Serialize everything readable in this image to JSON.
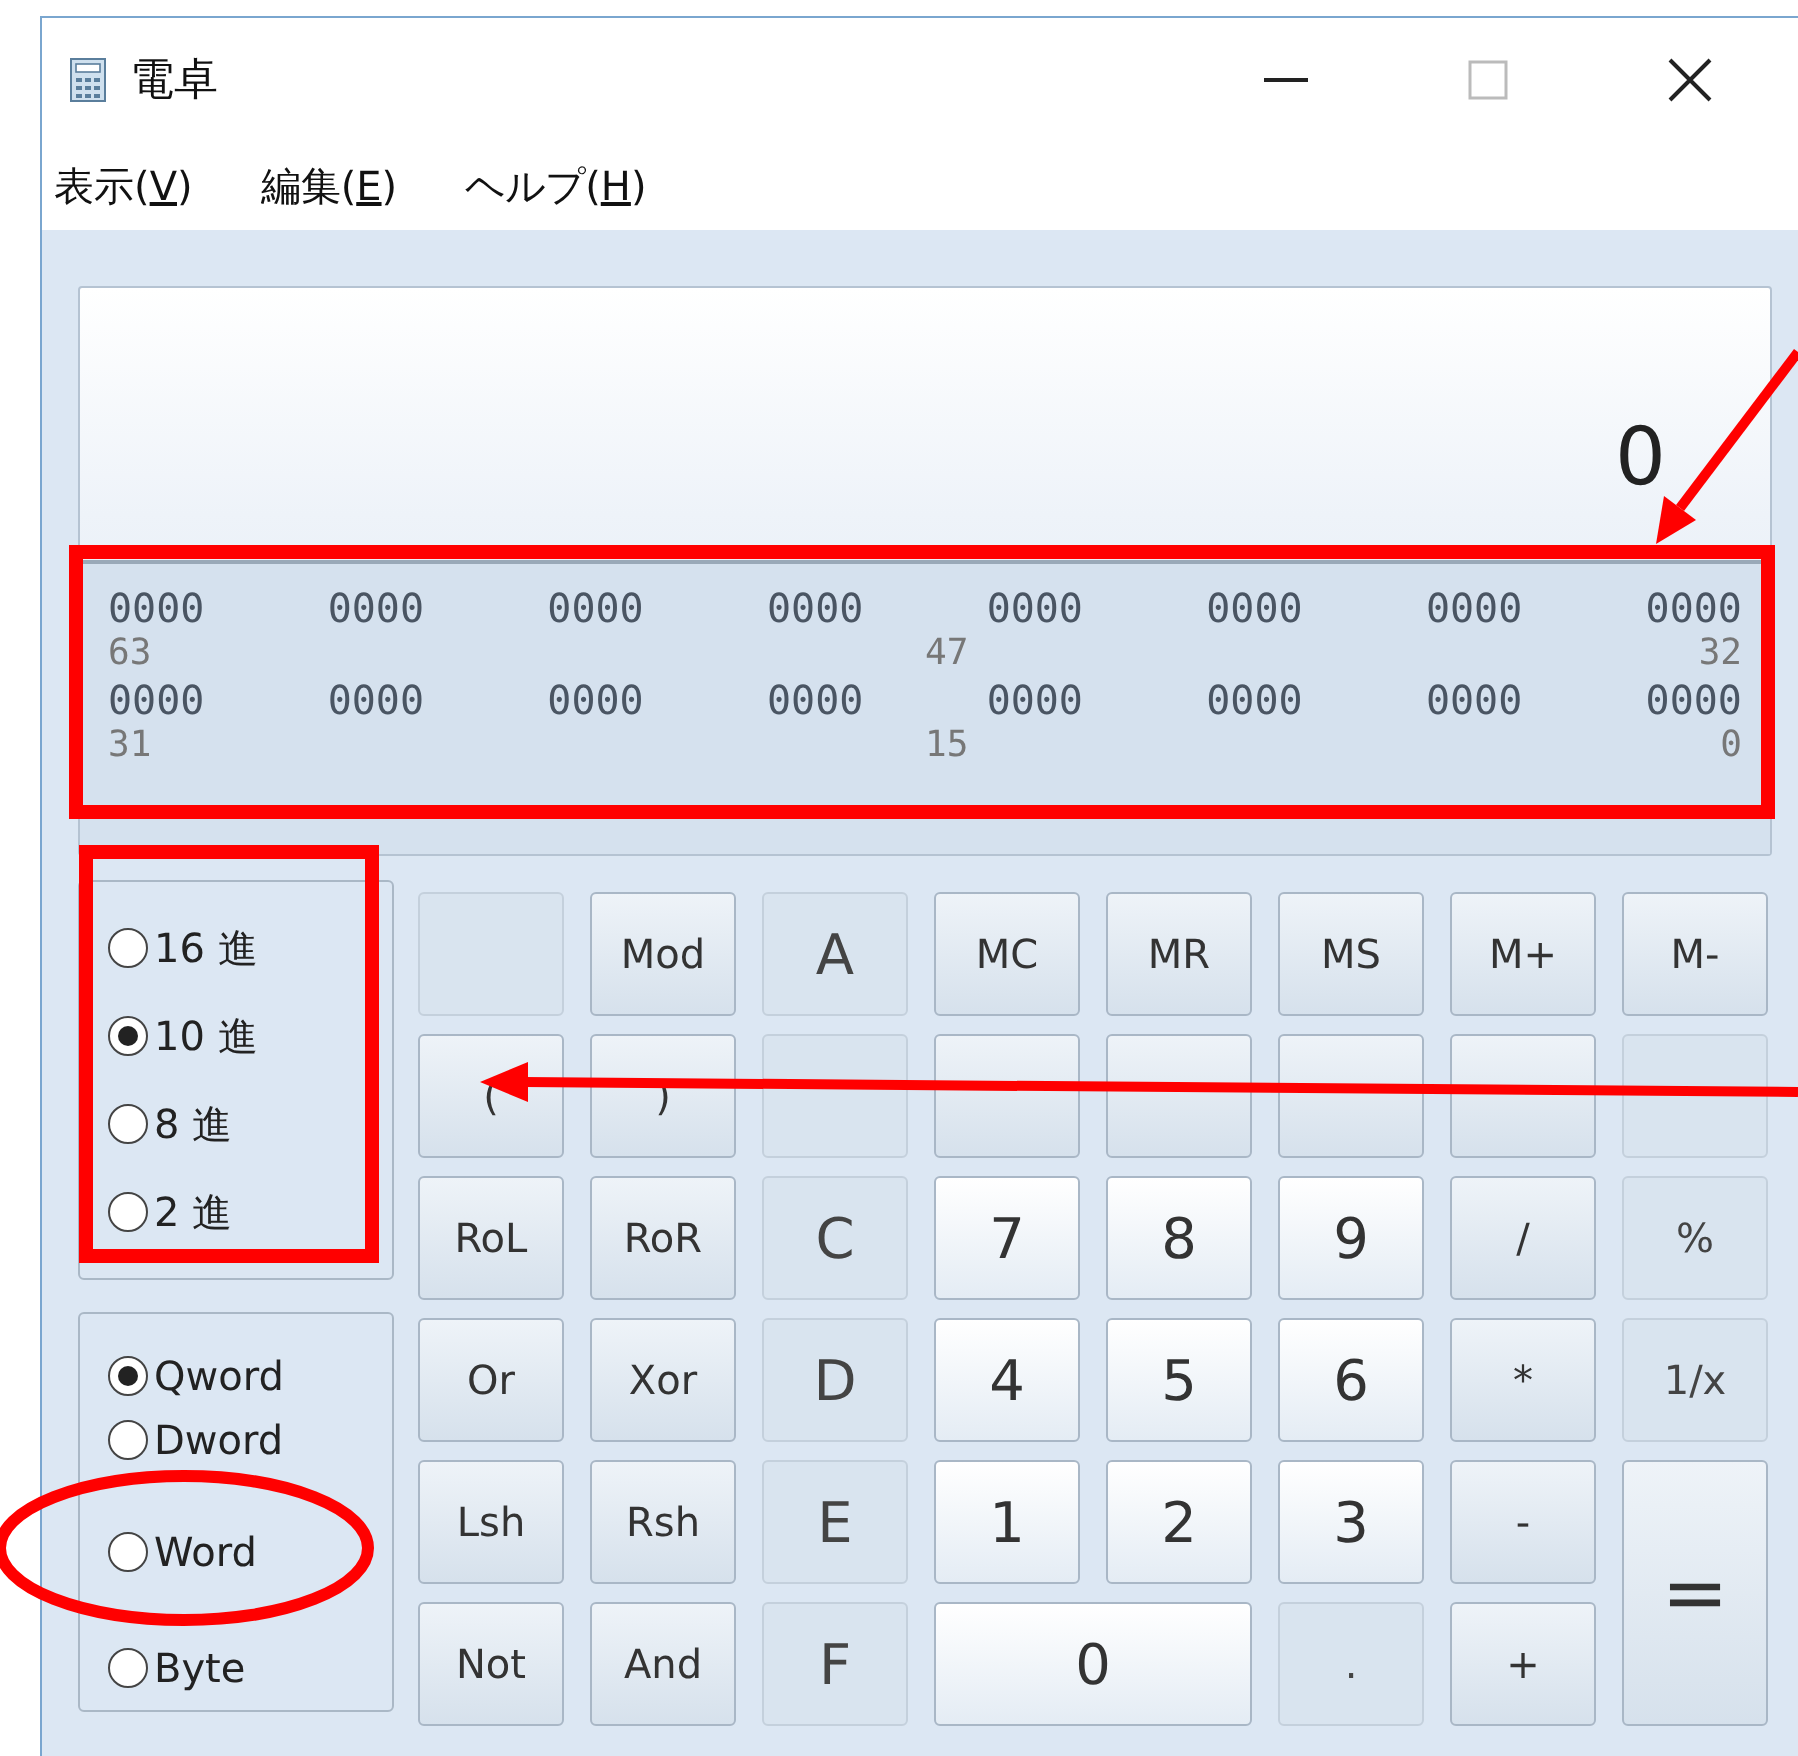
{
  "window": {
    "title": "電卓"
  },
  "menu": [
    {
      "before": "表示(",
      "key": "V",
      "after": ")"
    },
    {
      "before": "編集(",
      "key": "E",
      "after": ")"
    },
    {
      "before": "ヘルプ(",
      "key": "H",
      "after": ")"
    }
  ],
  "display": {
    "value": "0",
    "bit_rows": [
      {
        "digits": [
          "0000",
          "0000",
          "0000",
          "0000",
          "0000",
          "0000",
          "0000",
          "0000"
        ],
        "labels": [
          "63",
          "47",
          "32"
        ]
      },
      {
        "digits": [
          "0000",
          "0000",
          "0000",
          "0000",
          "0000",
          "0000",
          "0000",
          "0000"
        ],
        "labels": [
          "31",
          "15",
          "0"
        ]
      }
    ]
  },
  "radix": [
    {
      "label": "16 進",
      "selected": false
    },
    {
      "label": "10 進",
      "selected": true
    },
    {
      "label": "8 進",
      "selected": false
    },
    {
      "label": "2 進",
      "selected": false
    }
  ],
  "word_size": [
    {
      "label": "Qword",
      "selected": true
    },
    {
      "label": "Dword",
      "selected": false
    },
    {
      "label": "Word",
      "selected": false
    },
    {
      "label": "Byte",
      "selected": false
    }
  ],
  "keys": [
    {
      "kind": "normal",
      "disabled": true
    },
    {
      "label": "Mod",
      "kind": "normal",
      "disabled": false
    },
    {
      "label": "A",
      "kind": "normal",
      "disabled": true
    },
    {
      "label": "MC",
      "kind": "normal",
      "disabled": false
    },
    {
      "label": "MR",
      "kind": "normal",
      "disabled": false
    },
    {
      "label": "MS",
      "kind": "normal",
      "disabled": false
    },
    {
      "label": "M+",
      "kind": "normal",
      "disabled": false
    },
    {
      "label": "M-",
      "kind": "normal",
      "disabled": false
    },
    {
      "label": "(",
      "kind": "normal",
      "disabled": false
    },
    {
      "label": ")",
      "kind": "normal",
      "disabled": false
    },
    {
      "kind": "normal",
      "disabled": true
    },
    {
      "kind": "normal",
      "disabled": false
    },
    {
      "kind": "normal",
      "disabled": false
    },
    {
      "kind": "normal",
      "disabled": false
    },
    {
      "kind": "normal",
      "disabled": false
    },
    {
      "kind": "normal",
      "disabled": true
    },
    {
      "label": "RoL",
      "kind": "normal",
      "disabled": false
    },
    {
      "label": "RoR",
      "kind": "normal",
      "disabled": false
    },
    {
      "label": "C",
      "kind": "normal",
      "disabled": true
    },
    {
      "label": "7",
      "kind": "digit",
      "disabled": false
    },
    {
      "label": "8",
      "kind": "digit",
      "disabled": false
    },
    {
      "label": "9",
      "kind": "digit",
      "disabled": false
    },
    {
      "label": "/",
      "kind": "normal",
      "disabled": false
    },
    {
      "label": "%",
      "kind": "normal",
      "disabled": true
    },
    {
      "label": "Or",
      "kind": "normal",
      "disabled": false
    },
    {
      "label": "Xor",
      "kind": "normal",
      "disabled": false
    },
    {
      "label": "D",
      "kind": "normal",
      "disabled": true
    },
    {
      "label": "4",
      "kind": "digit",
      "disabled": false
    },
    {
      "label": "5",
      "kind": "digit",
      "disabled": false
    },
    {
      "label": "6",
      "kind": "digit",
      "disabled": false
    },
    {
      "label": "*",
      "kind": "normal",
      "disabled": false
    },
    {
      "label": "1/x",
      "kind": "normal",
      "disabled": true
    },
    {
      "label": "Lsh",
      "kind": "normal",
      "disabled": false
    },
    {
      "label": "Rsh",
      "kind": "normal",
      "disabled": false
    },
    {
      "label": "E",
      "kind": "normal",
      "disabled": true
    },
    {
      "label": "1",
      "kind": "digit",
      "disabled": false
    },
    {
      "label": "2",
      "kind": "digit",
      "disabled": false
    },
    {
      "label": "3",
      "kind": "digit",
      "disabled": false
    },
    {
      "label": "-",
      "kind": "normal",
      "disabled": false
    },
    {
      "label": "=",
      "kind": "tall",
      "disabled": false
    },
    {
      "label": "Not",
      "kind": "normal",
      "disabled": false
    },
    {
      "label": "And",
      "kind": "normal",
      "disabled": false
    },
    {
      "label": "F",
      "kind": "normal",
      "disabled": true
    },
    {
      "label": "0",
      "kind": "wide",
      "disabled": false
    },
    {
      "label": ".",
      "kind": "normal",
      "disabled": true
    },
    {
      "label": "+",
      "kind": "normal",
      "disabled": false
    }
  ]
}
